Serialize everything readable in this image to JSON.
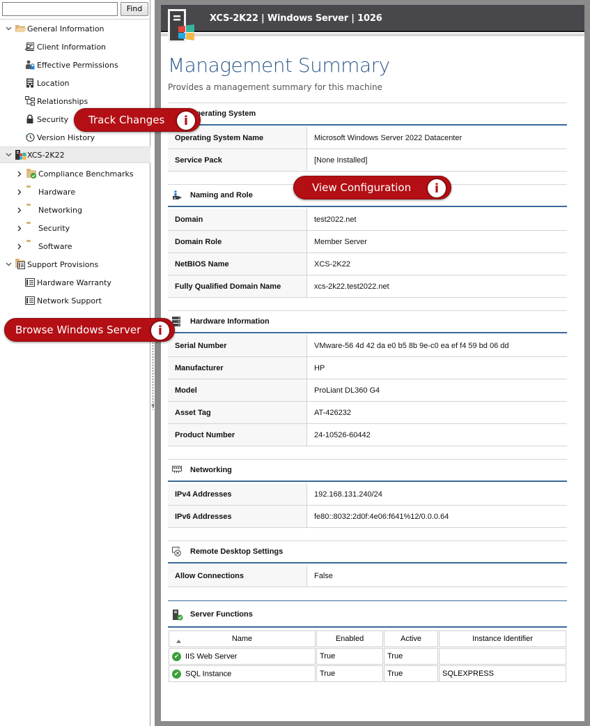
{
  "find": {
    "value": "",
    "placeholder": "",
    "button_label": "Find"
  },
  "tree": {
    "general_information": {
      "label": "General Information",
      "children": [
        "Client Information",
        "Effective Permissions",
        "Location",
        "Relationships",
        "Security",
        "Version History"
      ]
    },
    "machine": {
      "label": "XCS-2K22",
      "children": [
        "Compliance Benchmarks",
        "Hardware",
        "Networking",
        "Security",
        "Software"
      ]
    },
    "support_provisions": {
      "label": "Support Provisions",
      "children": [
        "Hardware Warranty",
        "Network Support"
      ]
    }
  },
  "header": {
    "title": "XCS-2K22 | Windows Server | 1026"
  },
  "page": {
    "title": "Management Summary",
    "subtitle": "Provides a management summary for this machine"
  },
  "sections": {
    "os": {
      "title": "Operating System",
      "rows": [
        {
          "key": "Operating System Name",
          "value": "Microsoft Windows Server 2022 Datacenter"
        },
        {
          "key": "Service Pack",
          "value": "[None Installed]"
        }
      ]
    },
    "naming": {
      "title": "Naming and Role",
      "rows": [
        {
          "key": "Domain",
          "value": "test2022.net"
        },
        {
          "key": "Domain Role",
          "value": "Member Server"
        },
        {
          "key": "NetBIOS Name",
          "value": "XCS-2K22"
        },
        {
          "key": "Fully Qualified Domain Name",
          "value": "xcs-2k22.test2022.net"
        }
      ]
    },
    "hardware": {
      "title": "Hardware Information",
      "rows": [
        {
          "key": "Serial Number",
          "value": "VMware-56 4d 42 da e0 b5 8b 9e-c0 ea ef f4 59 bd 06 dd"
        },
        {
          "key": "Manufacturer",
          "value": "HP"
        },
        {
          "key": "Model",
          "value": "ProLiant DL360 G4"
        },
        {
          "key": "Asset Tag",
          "value": "AT-426232"
        },
        {
          "key": "Product Number",
          "value": "24-10526-60442"
        }
      ]
    },
    "networking": {
      "title": "Networking",
      "rows": [
        {
          "key": "IPv4 Addresses",
          "value": "192.168.131.240/24"
        },
        {
          "key": "IPv6 Addresses",
          "value": "fe80::8032:2d0f:4e06:f641%12/0.0.0.64"
        }
      ]
    },
    "rdp": {
      "title": "Remote Desktop Settings",
      "rows": [
        {
          "key": "Allow Connections",
          "value": "False"
        }
      ]
    },
    "server_functions": {
      "title": "Server Functions",
      "columns": [
        "Name",
        "Enabled",
        "Active",
        "Instance Identifier"
      ],
      "sort": "ascending",
      "rows": [
        {
          "name": "IIS Web Server",
          "enabled": "True",
          "active": "True",
          "instance": "",
          "status": "ok"
        },
        {
          "name": "SQL Instance",
          "enabled": "True",
          "active": "True",
          "instance": "SQLEXPRESS",
          "status": "ok"
        }
      ]
    }
  },
  "callouts": {
    "track_changes": {
      "label": "Track Changes",
      "icon": "i"
    },
    "view_configuration": {
      "label": "View Configuration",
      "icon": "i"
    },
    "browse_windows_server": {
      "label": "Browse Windows Server",
      "icon": "i"
    }
  },
  "colors": {
    "accent_blue": "#2f5a8c",
    "section_rule": "#3a6899",
    "header_bg": "#48484c",
    "callout_red": "#b30f14",
    "status_ok": "#3aa03a",
    "folder": "#e1c088"
  }
}
